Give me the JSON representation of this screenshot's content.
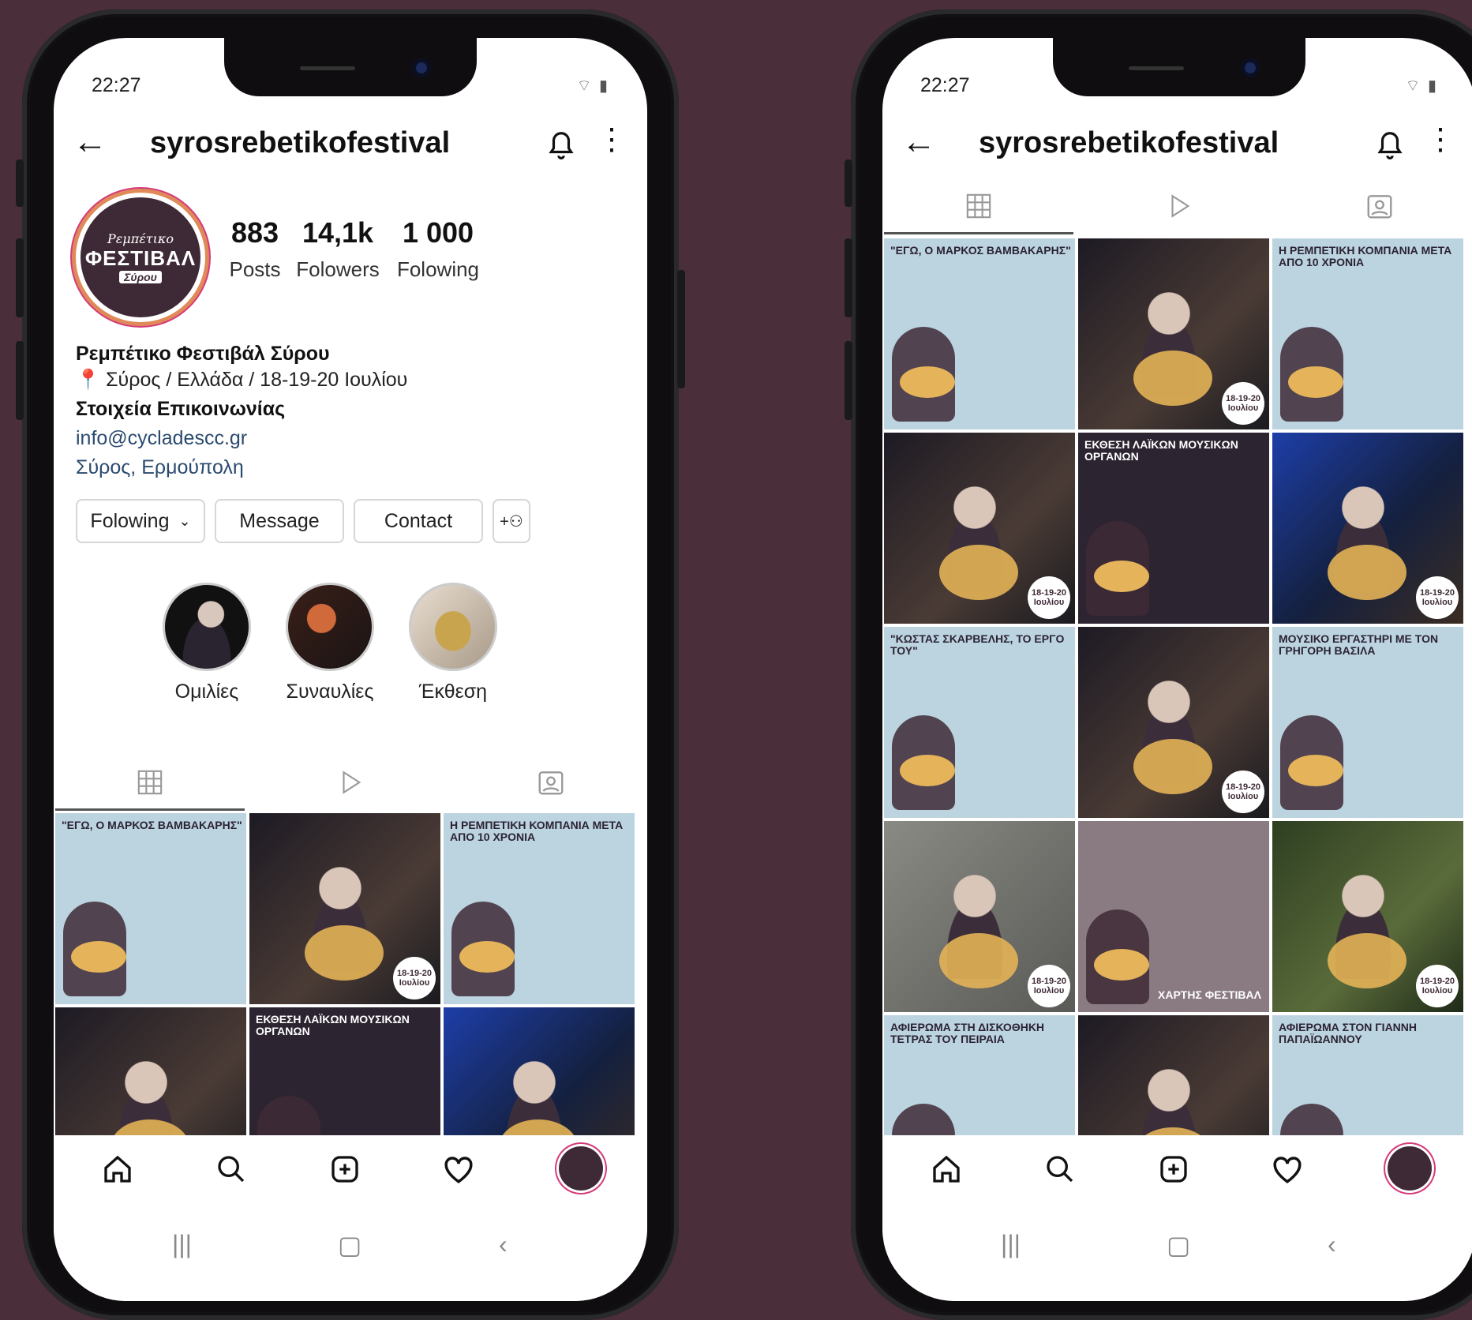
{
  "status": {
    "time": "22:27"
  },
  "profile": {
    "username": "syrosrebetikofestival",
    "logo": {
      "line1": "Ρεμπέτικο",
      "line2": "ΦΕΣΤΙΒΑΛ",
      "line3": "Σύρου"
    },
    "stats": [
      {
        "value": "883",
        "label": "Posts"
      },
      {
        "value": "14,1k",
        "label": "Folowers"
      },
      {
        "value": "1 000",
        "label": "Folowing"
      }
    ],
    "bio": {
      "name": "Ρεμπέτικο Φεστιβάλ Σύρου",
      "location": "Σύρος / Ελλάδα / 18-19-20 Ιουλίου",
      "contact_heading": "Στοιχεία Επικοινωνίας",
      "email": "info@cycladescc.gr",
      "address": "Σύρος, Ερμούπολη"
    },
    "actions": {
      "following": "Folowing",
      "message": "Message",
      "contact": "Contact"
    },
    "highlights": [
      {
        "label": "Ομιλίες"
      },
      {
        "label": "Συναυλίες"
      },
      {
        "label": "Έκθεση"
      }
    ]
  },
  "posts": [
    {
      "style": "light",
      "text": "\"ΕΓΩ, Ο ΜΑΡΚΟΣ ΒΑΜΒΑΚΑΡΗΣ\"",
      "date": ""
    },
    {
      "style": "photo",
      "text": "",
      "date": "18-19-20 Ιουλίου"
    },
    {
      "style": "light",
      "text": "Η ΡΕΜΠΕΤΙΚΗ ΚΟΜΠΑΝΙΑ ΜΕΤΑ ΑΠΟ 10 ΧΡΟΝΙΑ",
      "date": ""
    },
    {
      "style": "photo",
      "text": "",
      "date": "18-19-20 Ιουλίου"
    },
    {
      "style": "dark",
      "text": "ΕΚΘΕΣΗ ΛΑΪΚΩΝ ΜΟΥΣΙΚΩΝ ΟΡΓΑΝΩΝ",
      "date": ""
    },
    {
      "style": "blue",
      "text": "",
      "date": "18-19-20 Ιουλίου"
    },
    {
      "style": "light",
      "text": "\"ΚΩΣΤΑΣ ΣΚΑΡΒΕΛΗΣ, ΤΟ ΕΡΓΟ ΤΟΥ\"",
      "date": ""
    },
    {
      "style": "photo",
      "text": "",
      "date": "18-19-20 Ιουλίου"
    },
    {
      "style": "light",
      "text": "ΜΟΥΣΙΚΟ ΕΡΓΑΣΤΗΡΙ ΜΕ ΤΟΝ ΓΡΗΓΟΡΗ ΒΑΣΙΛΑ",
      "date": ""
    },
    {
      "style": "gray",
      "text": "",
      "date": "18-19-20 Ιουλίου"
    },
    {
      "style": "map",
      "text": "ΧΑΡΤΗΣ ΦΕΣΤΙΒΑΛ",
      "date": ""
    },
    {
      "style": "green",
      "text": "",
      "date": "18-19-20 Ιουλίου"
    },
    {
      "style": "light",
      "text": "ΑΦΙΕΡΩΜΑ ΣΤΗ ΔΙΣΚΟΘΗΚΗ ΤΕΤΡΑΣ ΤΟΥ ΠΕΙΡΑΙΑ",
      "date": ""
    },
    {
      "style": "photo",
      "text": "",
      "date": ""
    },
    {
      "style": "light",
      "text": "ΑΦΙΕΡΩΜΑ ΣΤΟΝ ΓΙΑΝΝΗ ΠΑΠΑΪΩΑΝΝΟΥ",
      "date": ""
    }
  ],
  "colors": {
    "background": "#4a2e3a",
    "brand": "#3e2a36",
    "story_ring": "#d43b7a"
  },
  "icons": [
    "back-arrow-icon",
    "bell-icon",
    "more-vertical-icon",
    "grid-icon",
    "reels-icon",
    "tagged-icon",
    "add-person-icon",
    "home-icon",
    "search-icon",
    "add-post-icon",
    "heart-icon",
    "recents-icon",
    "home-button-icon",
    "back-nav-icon"
  ]
}
